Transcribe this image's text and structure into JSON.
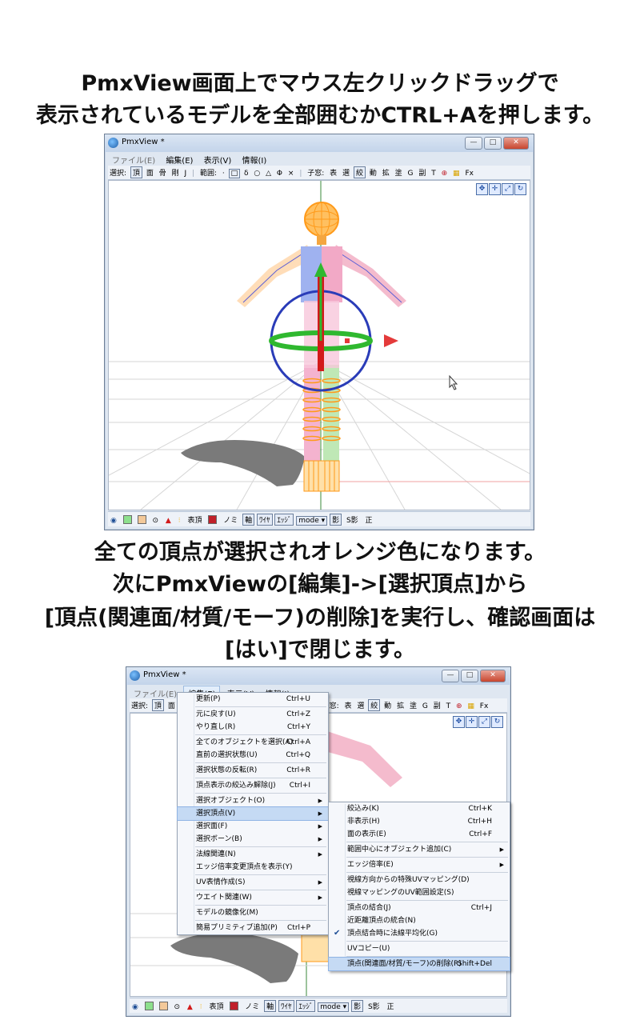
{
  "captions": {
    "top_line1": "PmxView画面上でマウス左クリックドラッグで",
    "top_line2": "表示されているモデルを全部囲むかCTRL+Aを押します。",
    "mid_line1": "全ての頂点が選択されオレンジ色になります。",
    "mid_line2": "次にPmxViewの[編集]->[選択頂点]から",
    "mid_line3": "[頂点(関連面/材質/モーフ)の削除]を実行し、確認画面は",
    "mid_line4": "[はい]で閉じます。"
  },
  "window": {
    "title": "PmxView *",
    "title2": "PmxView *",
    "controls": {
      "minimize": "—",
      "maximize": "□",
      "close": "✕"
    }
  },
  "menubar": {
    "file": "ファイル(E)",
    "edit": "編集(E)",
    "view": "表示(V)",
    "info": "情報(I)"
  },
  "toolbar": {
    "select_label": "選択:",
    "select_modes": [
      "頂",
      "面",
      "骨",
      "剛",
      "J"
    ],
    "range_label": "範囲:",
    "range_modes": [
      "·",
      "□",
      "δ",
      "○",
      "△",
      "Φ",
      "×"
    ],
    "child_label": "子窓:",
    "child_items": [
      "表",
      "選",
      "絞",
      "動",
      "拡",
      "塗",
      "G",
      "副",
      "T"
    ],
    "fx": "Fx"
  },
  "statusbar": {
    "table_label": "表頂",
    "material_label": "ノミ",
    "axis_label": "軸",
    "wire_label": "ﾜｲﾔ",
    "edge_label": "ｴｯｼﾞ",
    "mode_label": "mode ▾",
    "shadow_label": "影",
    "sshadow_label": "S影",
    "front_label": "正"
  },
  "icons": {
    "gizmo": [
      "move-cross-icon",
      "move-axis-icon",
      "scale-icon",
      "rotate-icon"
    ],
    "window": "pmxview-app-icon",
    "cursor": "mouse-cursor-icon"
  },
  "colors": {
    "selection_orange": "#ff9a1a",
    "axis_red": "#d21a1a",
    "axis_green": "#2fb82f",
    "axis_blue": "#2a3cb8",
    "menu_highlight": "#c5daf4"
  },
  "edit_menu": [
    {
      "label": "更新(P)",
      "shortcut": "Ctrl+U"
    },
    {
      "sep": true
    },
    {
      "label": "元に戻す(U)",
      "shortcut": "Ctrl+Z"
    },
    {
      "label": "やり直し(R)",
      "shortcut": "Ctrl+Y"
    },
    {
      "sep": true
    },
    {
      "label": "全てのオブジェクトを選択(A)",
      "shortcut": "Ctrl+A"
    },
    {
      "label": "直前の選択状態(U)",
      "shortcut": "Ctrl+Q"
    },
    {
      "sep": true
    },
    {
      "label": "選択状態の反転(R)",
      "shortcut": "Ctrl+R"
    },
    {
      "sep": true
    },
    {
      "label": "頂点表示の絞込み解除(J)",
      "shortcut": "Ctrl+I"
    },
    {
      "sep": true
    },
    {
      "label": "選択オブジェクト(O)",
      "submenu": true
    },
    {
      "label": "選択頂点(V)",
      "submenu": true,
      "highlighted": true
    },
    {
      "label": "選択面(F)",
      "submenu": true
    },
    {
      "label": "選択ボーン(B)",
      "submenu": true
    },
    {
      "sep": true
    },
    {
      "label": "法線関連(N)",
      "submenu": true
    },
    {
      "label": "エッジ倍率変更頂点を表示(Y)"
    },
    {
      "sep": true
    },
    {
      "label": "UV表情作成(S)",
      "submenu": true
    },
    {
      "sep": true
    },
    {
      "label": "ウエイト関連(W)",
      "submenu": true
    },
    {
      "sep": true
    },
    {
      "label": "モデルの鏡像化(M)"
    },
    {
      "sep": true
    },
    {
      "label": "簡易プリミティブ追加(P)",
      "shortcut": "Ctrl+P"
    }
  ],
  "vertex_submenu": [
    {
      "label": "絞込み(K)",
      "shortcut": "Ctrl+K"
    },
    {
      "label": "非表示(H)",
      "shortcut": "Ctrl+H"
    },
    {
      "label": "面の表示(E)",
      "shortcut": "Ctrl+F"
    },
    {
      "sep": true
    },
    {
      "label": "範囲中心にオブジェクト追加(C)",
      "submenu": true
    },
    {
      "sep": true
    },
    {
      "label": "エッジ倍率(E)",
      "submenu": true
    },
    {
      "sep": true
    },
    {
      "label": "視線方向からの特殊UVマッピング(D)"
    },
    {
      "label": "視線マッピングのUV範囲設定(S)"
    },
    {
      "sep": true
    },
    {
      "label": "頂点の結合(J)",
      "shortcut": "Ctrl+J"
    },
    {
      "label": "近距離頂点の統合(N)"
    },
    {
      "label": "頂点結合時に法線平均化(G)",
      "checked": true
    },
    {
      "sep": true
    },
    {
      "label": "UVコピー(U)"
    },
    {
      "sep": true
    },
    {
      "label": "頂点(関連面/材質/モーフ)の削除(R)",
      "shortcut": "Shift+Del",
      "highlighted": true
    }
  ]
}
